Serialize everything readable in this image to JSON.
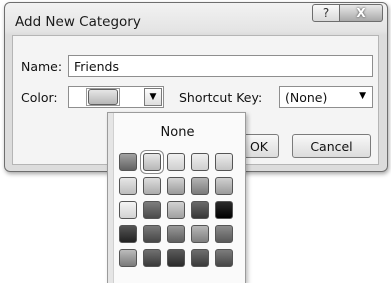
{
  "dialog": {
    "title": "Add New Category",
    "help_glyph": "?",
    "close_glyph": "X"
  },
  "form": {
    "name_label": "Name:",
    "name_value": "Friends",
    "color_label": "Color:",
    "shortcut_label": "Shortcut Key:",
    "shortcut_value": "(None)",
    "ok_label": "OK",
    "cancel_label": "Cancel"
  },
  "color_picker": {
    "none_label": "None",
    "selected_index": 1,
    "swatches": [
      {
        "top": "#a2a2a2",
        "bottom": "#626262"
      },
      {
        "top": "#e6e6e6",
        "bottom": "#b6b6b6"
      },
      {
        "top": "#f0f0f0",
        "bottom": "#cfcfcf"
      },
      {
        "top": "#f0f0f0",
        "bottom": "#cfcfcf"
      },
      {
        "top": "#ececec",
        "bottom": "#c4c4c4"
      },
      {
        "top": "#e6e6e6",
        "bottom": "#bdbdbd"
      },
      {
        "top": "#dedede",
        "bottom": "#ababab"
      },
      {
        "top": "#d4d4d4",
        "bottom": "#9a9a9a"
      },
      {
        "top": "#b4b4b4",
        "bottom": "#7a7a7a"
      },
      {
        "top": "#d0d0d0",
        "bottom": "#9a9a9a"
      },
      {
        "top": "#f4f4f4",
        "bottom": "#d2d2d2"
      },
      {
        "top": "#7e7e7e",
        "bottom": "#4a4a4a"
      },
      {
        "top": "#d2d2d2",
        "bottom": "#a0a0a0"
      },
      {
        "top": "#6a6a6a",
        "bottom": "#363636"
      },
      {
        "top": "#2a2a2a",
        "bottom": "#000000"
      },
      {
        "top": "#555555",
        "bottom": "#222222"
      },
      {
        "top": "#7a7a7a",
        "bottom": "#464646"
      },
      {
        "top": "#999999",
        "bottom": "#5e5e5e"
      },
      {
        "top": "#b8b8b8",
        "bottom": "#7e7e7e"
      },
      {
        "top": "#8c8c8c",
        "bottom": "#585858"
      },
      {
        "top": "#bcbcbc",
        "bottom": "#7a7a7a"
      },
      {
        "top": "#707070",
        "bottom": "#3a3a3a"
      },
      {
        "top": "#5a5a5a",
        "bottom": "#2a2a2a"
      },
      {
        "top": "#6e6e6e",
        "bottom": "#3a3a3a"
      },
      {
        "top": "#7c7c7c",
        "bottom": "#464646"
      }
    ]
  }
}
